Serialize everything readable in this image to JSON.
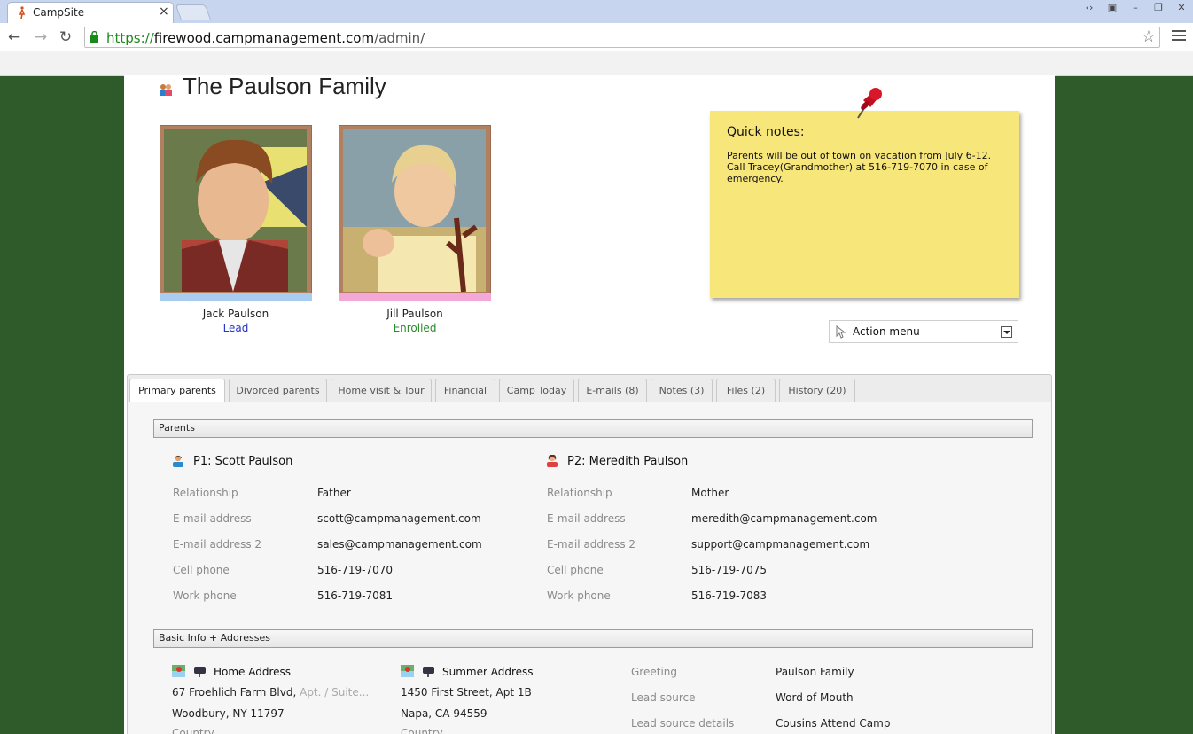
{
  "browser": {
    "tab_title": "CampSite",
    "close_symbol": "×",
    "url_scheme": "https://",
    "url_host": "firewood.campmanagement.com",
    "url_path": "/admin/",
    "back_icon": "←",
    "forward_icon": "→",
    "reload_icon": "↻",
    "star_icon": "☆"
  },
  "family": {
    "title": "The Paulson Family",
    "children": [
      {
        "name": "Jack Paulson",
        "status": "Lead",
        "status_color": "#2233cc",
        "frame_accent": "#a9cdf0"
      },
      {
        "name": "Jill Paulson",
        "status": "Enrolled",
        "status_color": "#2a8a2a",
        "frame_accent": "#f4a8d8"
      }
    ]
  },
  "quick_notes": {
    "title": "Quick notes:",
    "body": "Parents will be out of town on vacation from July 6-12. Call Tracey(Grandmother) at 516-719-7070 in case of emergency."
  },
  "action_menu": {
    "label": "Action menu"
  },
  "tabs": [
    {
      "label": "Primary parents",
      "active": true
    },
    {
      "label": "Divorced parents"
    },
    {
      "label": "Home visit & Tour"
    },
    {
      "label": "Financial"
    },
    {
      "label": "Camp Today"
    },
    {
      "label": "E-mails (8)"
    },
    {
      "label": "Notes (3)"
    },
    {
      "label": "Files (2)"
    },
    {
      "label": "History (20)"
    }
  ],
  "parents_section": {
    "title": "Parents",
    "field_labels": [
      "Relationship",
      "E-mail address",
      "E-mail address 2",
      "Cell phone",
      "Work phone"
    ],
    "p1": {
      "heading": "P1: Scott Paulson",
      "values": [
        "Father",
        "scott@campmanagement.com",
        "sales@campmanagement.com",
        "516-719-7070",
        "516-719-7081"
      ]
    },
    "p2": {
      "heading": "P2: Meredith Paulson",
      "values": [
        "Mother",
        "meredith@campmanagement.com",
        "support@campmanagement.com",
        "516-719-7075",
        "516-719-7083"
      ]
    }
  },
  "basic_section": {
    "title": "Basic Info + Addresses",
    "home": {
      "heading": "Home Address",
      "street": "67 Froehlich Farm Blvd,",
      "suite_placeholder": "Apt. / Suite...",
      "city": "Woodbury, NY 11797",
      "country_label": "Country"
    },
    "summer": {
      "heading": "Summer Address",
      "street": "1450 First Street, Apt 1B",
      "city": "Napa, CA 94559",
      "country_label": "Country"
    },
    "info_labels": [
      "Greeting",
      "Lead source",
      "Lead source details"
    ],
    "info_values": [
      "Paulson Family",
      "Word of Mouth",
      "Cousins Attend Camp"
    ]
  }
}
